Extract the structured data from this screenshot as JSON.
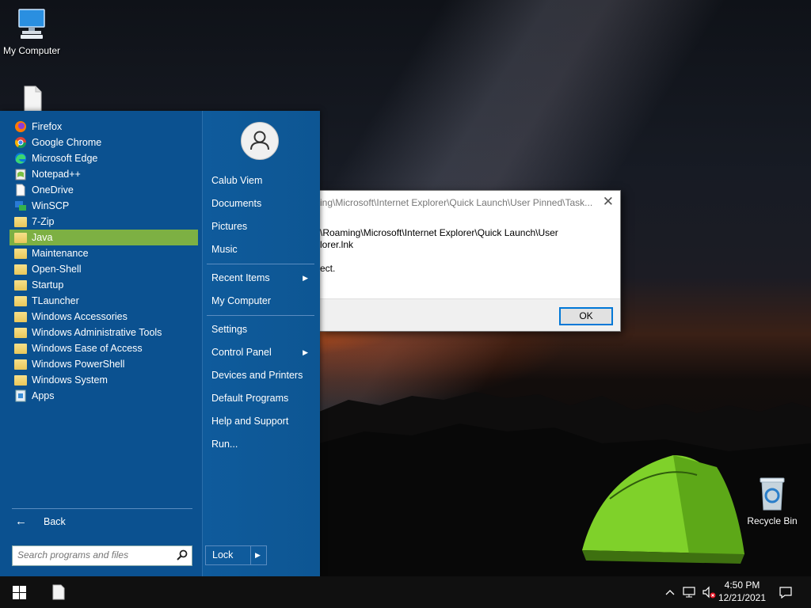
{
  "desktop": {
    "icons": [
      {
        "label": "My Computer",
        "icon": "monitor-icon"
      },
      {
        "label": "",
        "icon": "file-icon"
      },
      {
        "label": "Recycle Bin",
        "icon": "recycle-bin-icon"
      }
    ]
  },
  "start_menu": {
    "programs": [
      {
        "label": "Firefox",
        "icon": "firefox-icon"
      },
      {
        "label": "Google Chrome",
        "icon": "chrome-icon"
      },
      {
        "label": "Microsoft Edge",
        "icon": "edge-icon"
      },
      {
        "label": "Notepad++",
        "icon": "notepad-plus-plus-icon"
      },
      {
        "label": "OneDrive",
        "icon": "file-icon"
      },
      {
        "label": "WinSCP",
        "icon": "winscp-icon"
      },
      {
        "label": "7-Zip",
        "icon": "folder-icon"
      },
      {
        "label": "Java",
        "icon": "folder-icon",
        "selected": true
      },
      {
        "label": "Maintenance",
        "icon": "folder-icon"
      },
      {
        "label": "Open-Shell",
        "icon": "folder-icon"
      },
      {
        "label": "Startup",
        "icon": "folder-icon"
      },
      {
        "label": "TLauncher",
        "icon": "folder-icon"
      },
      {
        "label": "Windows Accessories",
        "icon": "folder-icon"
      },
      {
        "label": "Windows Administrative Tools",
        "icon": "folder-icon"
      },
      {
        "label": "Windows Ease of Access",
        "icon": "folder-icon"
      },
      {
        "label": "Windows PowerShell",
        "icon": "folder-icon"
      },
      {
        "label": "Windows System",
        "icon": "folder-icon"
      },
      {
        "label": "Apps",
        "icon": "apps-icon"
      }
    ],
    "back_label": "Back",
    "search_placeholder": "Search programs and files",
    "right": {
      "user_name": "Calub Viem",
      "documents": "Documents",
      "pictures": "Pictures",
      "music": "Music",
      "recent_items": "Recent Items",
      "my_computer": "My Computer",
      "settings": "Settings",
      "control_panel": "Control Panel",
      "devices_printers": "Devices and Printers",
      "default_programs": "Default Programs",
      "help_support": "Help and Support",
      "run": "Run...",
      "lock": "Lock"
    },
    "colors": {
      "background": "#0b5190",
      "selected": "#7db043"
    }
  },
  "dialog": {
    "title": "ing\\Microsoft\\Internet Explorer\\Quick Launch\\User Pinned\\Task...",
    "message_line1": "\\Roaming\\Microsoft\\Internet Explorer\\Quick Launch\\User",
    "message_line2": "lorer.lnk",
    "message_line3": "ect.",
    "ok_label": "OK"
  },
  "taskbar": {
    "time": "4:50 PM",
    "date": "12/21/2021"
  }
}
